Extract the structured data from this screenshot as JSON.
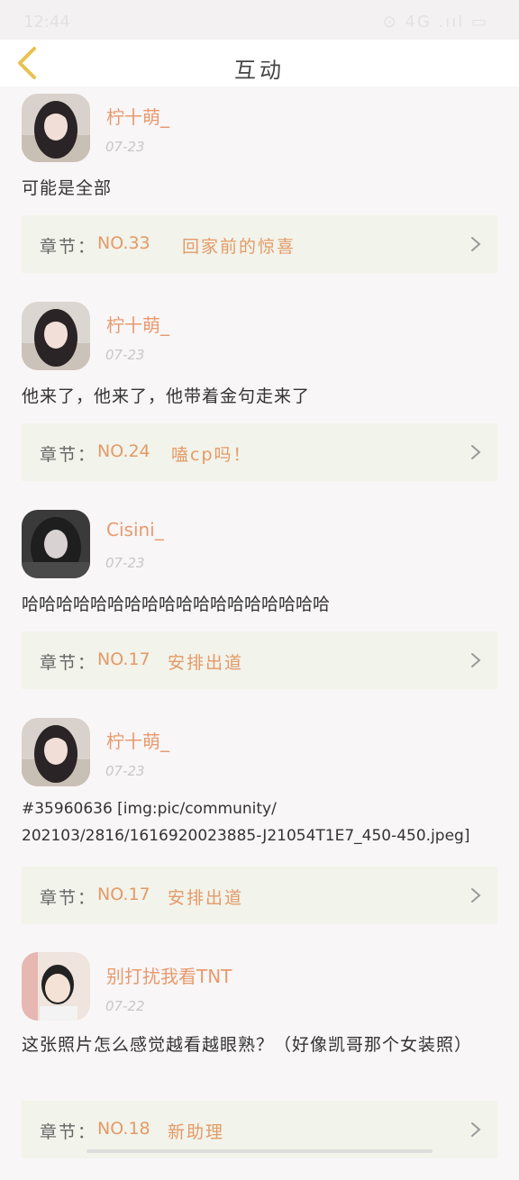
{
  "status": {
    "time": "12:44",
    "icons": "⊙ 4G .ııl ▭"
  },
  "header": {
    "title": "互动"
  },
  "posts": [
    {
      "user": "柠十萌_",
      "date": "07-23",
      "text": "可能是全部",
      "chapter_label": "章节：",
      "chapter_no": "NO.33",
      "chapter_name": "回家前的惊喜"
    },
    {
      "user": "柠十萌_",
      "date": "07-23",
      "text": "他来了，他来了，他带着金句走来了",
      "chapter_label": "章节：",
      "chapter_no": "NO.24",
      "chapter_name": "嗑cp吗！"
    },
    {
      "user": "Cisini_",
      "date": "07-23",
      "text": "哈哈哈哈哈哈哈哈哈哈哈哈哈哈哈哈哈哈",
      "chapter_label": "章节：",
      "chapter_no": "NO.17",
      "chapter_name": "安排出道"
    },
    {
      "user": "柠十萌_",
      "date": "07-23",
      "text": "#35960636 [img:pic/community/\n202103/2816/1616920023885-J21054T1E7_450-450.jpeg]",
      "chapter_label": "章节：",
      "chapter_no": "NO.17",
      "chapter_name": "安排出道"
    },
    {
      "user": "别打扰我看TNT",
      "date": "07-22",
      "text": "这张照片怎么感觉越看越眼熟？（好像凯哥那个女装照）",
      "chapter_label": "章节：",
      "chapter_no": "NO.18",
      "chapter_name": "新助理"
    }
  ],
  "colors": {
    "username": "#e89a6e",
    "chapter_bg": "#f2f3ea",
    "accent": "#e39a68",
    "back_arrow": "#e8c24e"
  }
}
